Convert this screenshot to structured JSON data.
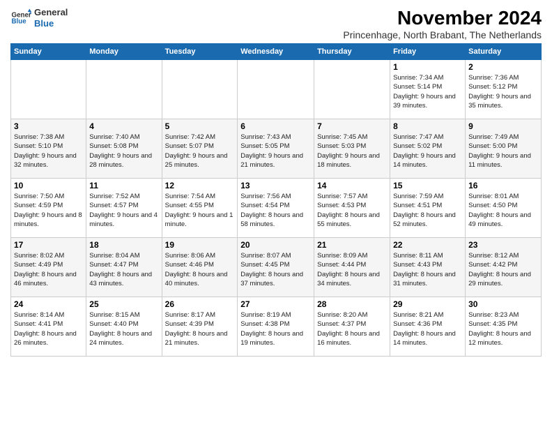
{
  "header": {
    "logo_line1": "General",
    "logo_line2": "Blue",
    "title": "November 2024",
    "subtitle": "Princenhage, North Brabant, The Netherlands"
  },
  "weekdays": [
    "Sunday",
    "Monday",
    "Tuesday",
    "Wednesday",
    "Thursday",
    "Friday",
    "Saturday"
  ],
  "weeks": [
    [
      {
        "day": "",
        "info": ""
      },
      {
        "day": "",
        "info": ""
      },
      {
        "day": "",
        "info": ""
      },
      {
        "day": "",
        "info": ""
      },
      {
        "day": "",
        "info": ""
      },
      {
        "day": "1",
        "info": "Sunrise: 7:34 AM\nSunset: 5:14 PM\nDaylight: 9 hours and 39 minutes."
      },
      {
        "day": "2",
        "info": "Sunrise: 7:36 AM\nSunset: 5:12 PM\nDaylight: 9 hours and 35 minutes."
      }
    ],
    [
      {
        "day": "3",
        "info": "Sunrise: 7:38 AM\nSunset: 5:10 PM\nDaylight: 9 hours and 32 minutes."
      },
      {
        "day": "4",
        "info": "Sunrise: 7:40 AM\nSunset: 5:08 PM\nDaylight: 9 hours and 28 minutes."
      },
      {
        "day": "5",
        "info": "Sunrise: 7:42 AM\nSunset: 5:07 PM\nDaylight: 9 hours and 25 minutes."
      },
      {
        "day": "6",
        "info": "Sunrise: 7:43 AM\nSunset: 5:05 PM\nDaylight: 9 hours and 21 minutes."
      },
      {
        "day": "7",
        "info": "Sunrise: 7:45 AM\nSunset: 5:03 PM\nDaylight: 9 hours and 18 minutes."
      },
      {
        "day": "8",
        "info": "Sunrise: 7:47 AM\nSunset: 5:02 PM\nDaylight: 9 hours and 14 minutes."
      },
      {
        "day": "9",
        "info": "Sunrise: 7:49 AM\nSunset: 5:00 PM\nDaylight: 9 hours and 11 minutes."
      }
    ],
    [
      {
        "day": "10",
        "info": "Sunrise: 7:50 AM\nSunset: 4:59 PM\nDaylight: 9 hours and 8 minutes."
      },
      {
        "day": "11",
        "info": "Sunrise: 7:52 AM\nSunset: 4:57 PM\nDaylight: 9 hours and 4 minutes."
      },
      {
        "day": "12",
        "info": "Sunrise: 7:54 AM\nSunset: 4:55 PM\nDaylight: 9 hours and 1 minute."
      },
      {
        "day": "13",
        "info": "Sunrise: 7:56 AM\nSunset: 4:54 PM\nDaylight: 8 hours and 58 minutes."
      },
      {
        "day": "14",
        "info": "Sunrise: 7:57 AM\nSunset: 4:53 PM\nDaylight: 8 hours and 55 minutes."
      },
      {
        "day": "15",
        "info": "Sunrise: 7:59 AM\nSunset: 4:51 PM\nDaylight: 8 hours and 52 minutes."
      },
      {
        "day": "16",
        "info": "Sunrise: 8:01 AM\nSunset: 4:50 PM\nDaylight: 8 hours and 49 minutes."
      }
    ],
    [
      {
        "day": "17",
        "info": "Sunrise: 8:02 AM\nSunset: 4:49 PM\nDaylight: 8 hours and 46 minutes."
      },
      {
        "day": "18",
        "info": "Sunrise: 8:04 AM\nSunset: 4:47 PM\nDaylight: 8 hours and 43 minutes."
      },
      {
        "day": "19",
        "info": "Sunrise: 8:06 AM\nSunset: 4:46 PM\nDaylight: 8 hours and 40 minutes."
      },
      {
        "day": "20",
        "info": "Sunrise: 8:07 AM\nSunset: 4:45 PM\nDaylight: 8 hours and 37 minutes."
      },
      {
        "day": "21",
        "info": "Sunrise: 8:09 AM\nSunset: 4:44 PM\nDaylight: 8 hours and 34 minutes."
      },
      {
        "day": "22",
        "info": "Sunrise: 8:11 AM\nSunset: 4:43 PM\nDaylight: 8 hours and 31 minutes."
      },
      {
        "day": "23",
        "info": "Sunrise: 8:12 AM\nSunset: 4:42 PM\nDaylight: 8 hours and 29 minutes."
      }
    ],
    [
      {
        "day": "24",
        "info": "Sunrise: 8:14 AM\nSunset: 4:41 PM\nDaylight: 8 hours and 26 minutes."
      },
      {
        "day": "25",
        "info": "Sunrise: 8:15 AM\nSunset: 4:40 PM\nDaylight: 8 hours and 24 minutes."
      },
      {
        "day": "26",
        "info": "Sunrise: 8:17 AM\nSunset: 4:39 PM\nDaylight: 8 hours and 21 minutes."
      },
      {
        "day": "27",
        "info": "Sunrise: 8:19 AM\nSunset: 4:38 PM\nDaylight: 8 hours and 19 minutes."
      },
      {
        "day": "28",
        "info": "Sunrise: 8:20 AM\nSunset: 4:37 PM\nDaylight: 8 hours and 16 minutes."
      },
      {
        "day": "29",
        "info": "Sunrise: 8:21 AM\nSunset: 4:36 PM\nDaylight: 8 hours and 14 minutes."
      },
      {
        "day": "30",
        "info": "Sunrise: 8:23 AM\nSunset: 4:35 PM\nDaylight: 8 hours and 12 minutes."
      }
    ]
  ]
}
